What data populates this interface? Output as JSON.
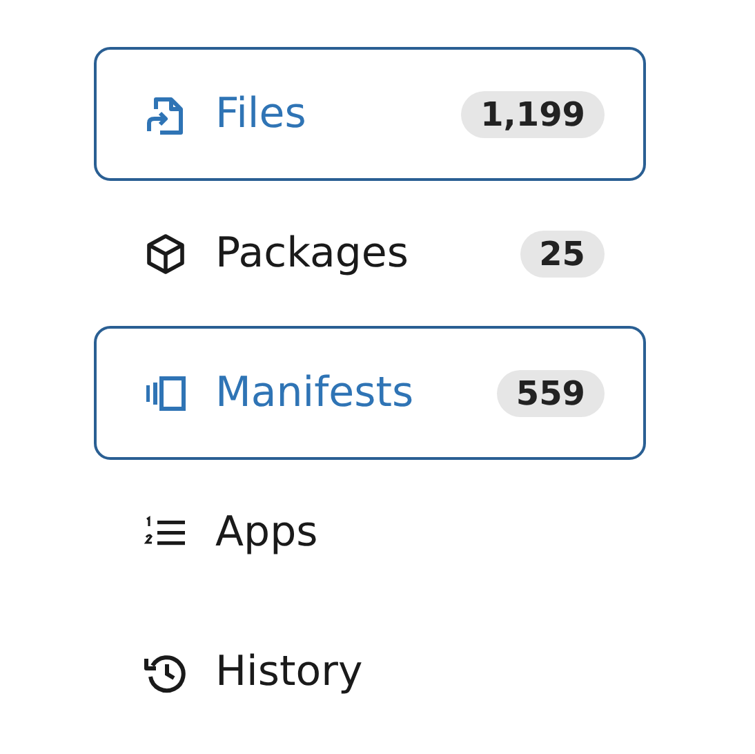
{
  "nav_items": [
    {
      "kind": "files",
      "label": "Files",
      "count": "1,199",
      "selected": true
    },
    {
      "kind": "packages",
      "label": "Packages",
      "count": "25",
      "selected": false
    },
    {
      "kind": "manifests",
      "label": "Manifests",
      "count": "559",
      "selected": true
    },
    {
      "kind": "apps",
      "label": "Apps",
      "selected": false
    },
    {
      "kind": "history",
      "label": "History",
      "selected": false
    }
  ]
}
